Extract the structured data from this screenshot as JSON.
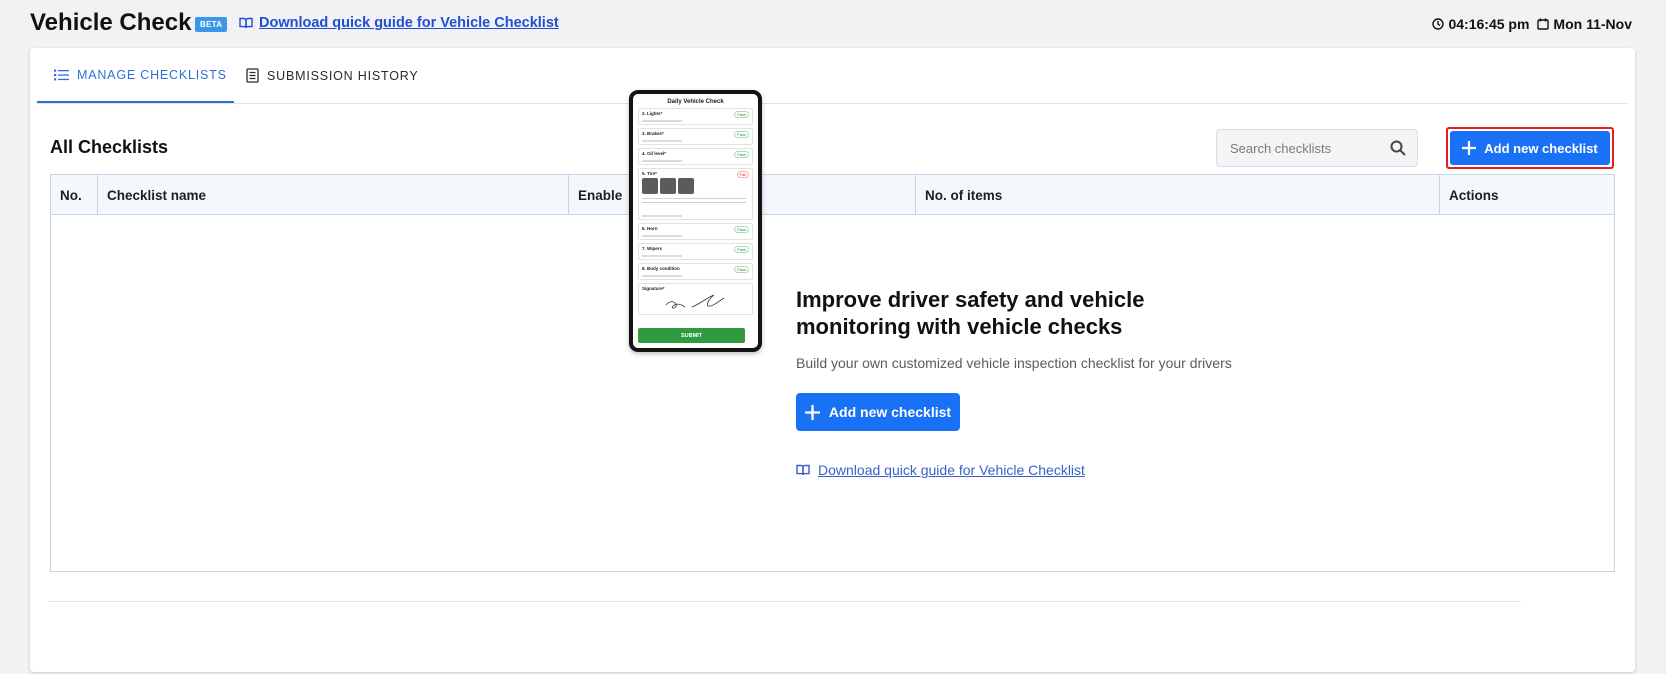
{
  "header": {
    "title": "Vehicle Check",
    "badge": "BETA",
    "guide_link": "Download quick guide for Vehicle Checklist",
    "time": "04:16:45 pm",
    "date": "Mon 11-Nov"
  },
  "tabs": [
    {
      "label": "MANAGE CHECKLISTS",
      "active": true
    },
    {
      "label": "SUBMISSION HISTORY",
      "active": false
    }
  ],
  "section": {
    "title": "All Checklists",
    "search_placeholder": "Search checklists",
    "add_button": "Add new checklist"
  },
  "table": {
    "columns": [
      "No.",
      "Checklist name",
      "Enable",
      "No. of items",
      "Actions"
    ]
  },
  "empty_state": {
    "title": "Improve driver safety and vehicle monitoring with vehicle checks",
    "subtitle": "Build your own customized vehicle inspection checklist for your drivers",
    "add_button": "Add new checklist",
    "guide_link": "Download quick guide for Vehicle Checklist"
  },
  "phone_preview": {
    "title": "Daily Vehicle Check",
    "items": [
      {
        "label": "2. Lights*",
        "status": "Pass"
      },
      {
        "label": "3. Brakes*",
        "status": "Pass"
      },
      {
        "label": "4. Oil level*",
        "status": "Pass"
      },
      {
        "label": "5. Tire*",
        "status": "Fail"
      },
      {
        "label": "6. Horn",
        "status": "Pass"
      },
      {
        "label": "7. Wipers",
        "status": "Pass"
      },
      {
        "label": "8. Body condition",
        "status": "Pass"
      }
    ],
    "signature_label": "Signature*",
    "submit": "SUBMIT"
  },
  "colors": {
    "primary": "#1971f5",
    "active_tab": "#2d6fd8",
    "highlight_border": "#e41e1e",
    "badge": "#3d97e8"
  }
}
